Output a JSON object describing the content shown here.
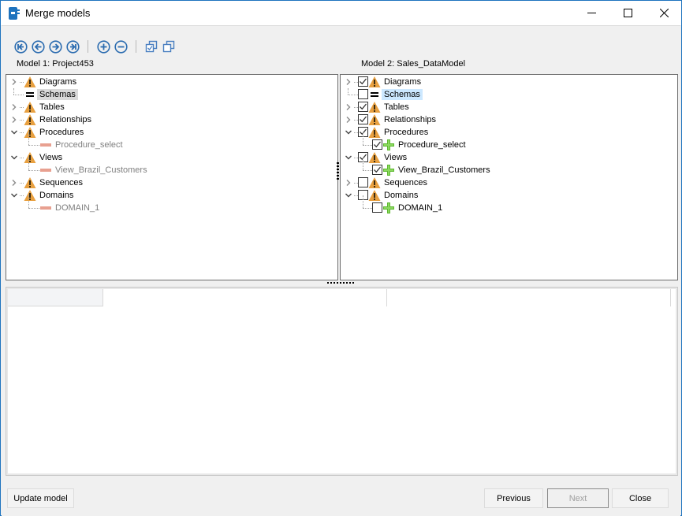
{
  "window": {
    "title": "Merge models",
    "controls": {
      "minimize": "minimize",
      "maximize": "maximize",
      "close": "close"
    }
  },
  "toolbar": {
    "buttons": [
      {
        "name": "first-difference",
        "icon": "nav-first-icon"
      },
      {
        "name": "previous-difference",
        "icon": "nav-prev-icon"
      },
      {
        "name": "next-difference",
        "icon": "nav-next-icon"
      },
      {
        "name": "last-difference",
        "icon": "nav-last-icon"
      },
      {
        "name": "expand-all",
        "icon": "plus-circle-icon"
      },
      {
        "name": "collapse-all",
        "icon": "minus-circle-icon"
      },
      {
        "name": "check-all",
        "icon": "check-all-icon"
      },
      {
        "name": "uncheck-all",
        "icon": "uncheck-all-icon"
      }
    ]
  },
  "model1": {
    "label": "Model 1: Project453",
    "tree": [
      {
        "label": "Diagrams",
        "icon": "warning",
        "expander": "collapsed"
      },
      {
        "label": "Schemas",
        "icon": "equal",
        "expander": "none",
        "selected": true
      },
      {
        "label": "Tables",
        "icon": "warning",
        "expander": "collapsed"
      },
      {
        "label": "Relationships",
        "icon": "warning",
        "expander": "collapsed"
      },
      {
        "label": "Procedures",
        "icon": "warning",
        "expander": "expanded"
      },
      {
        "label": "Procedure_select",
        "icon": "missing",
        "child": true
      },
      {
        "label": "Views",
        "icon": "warning",
        "expander": "expanded"
      },
      {
        "label": "View_Brazil_Customers",
        "icon": "missing",
        "child": true
      },
      {
        "label": "Sequences",
        "icon": "warning",
        "expander": "collapsed"
      },
      {
        "label": "Domains",
        "icon": "warning",
        "expander": "expanded"
      },
      {
        "label": "DOMAIN_1",
        "icon": "missing",
        "child": true
      }
    ]
  },
  "model2": {
    "label": "Model 2: Sales_DataModel",
    "tree": [
      {
        "label": "Diagrams",
        "icon": "warning",
        "expander": "collapsed",
        "checked": true
      },
      {
        "label": "Schemas",
        "icon": "equal",
        "expander": "none",
        "checked": false,
        "selected": true
      },
      {
        "label": "Tables",
        "icon": "warning",
        "expander": "collapsed",
        "checked": true
      },
      {
        "label": "Relationships",
        "icon": "warning",
        "expander": "collapsed",
        "checked": true
      },
      {
        "label": "Procedures",
        "icon": "warning",
        "expander": "expanded",
        "checked": true
      },
      {
        "label": "Procedure_select",
        "icon": "add",
        "child": true,
        "checked": true
      },
      {
        "label": "Views",
        "icon": "warning",
        "expander": "expanded",
        "checked": true
      },
      {
        "label": "View_Brazil_Customers",
        "icon": "add",
        "child": true,
        "checked": true
      },
      {
        "label": "Sequences",
        "icon": "warning",
        "expander": "collapsed",
        "checked": false
      },
      {
        "label": "Domains",
        "icon": "warning",
        "expander": "expanded",
        "checked": false
      },
      {
        "label": "DOMAIN_1",
        "icon": "add",
        "child": true,
        "checked": false
      }
    ]
  },
  "grid": {
    "columns": [
      "",
      "",
      ""
    ]
  },
  "footer": {
    "update_model": "Update model",
    "previous": "Previous",
    "next": "Next",
    "next_enabled": false,
    "close": "Close"
  },
  "colors": {
    "accent": "#1e73be",
    "nav_icon": "#2b6cb0",
    "warning": "#e8a040",
    "missing": "#e8a090",
    "add": "#5cb82e",
    "selection_blue": "#cce8ff",
    "selection_gray": "#d9d9d9"
  }
}
